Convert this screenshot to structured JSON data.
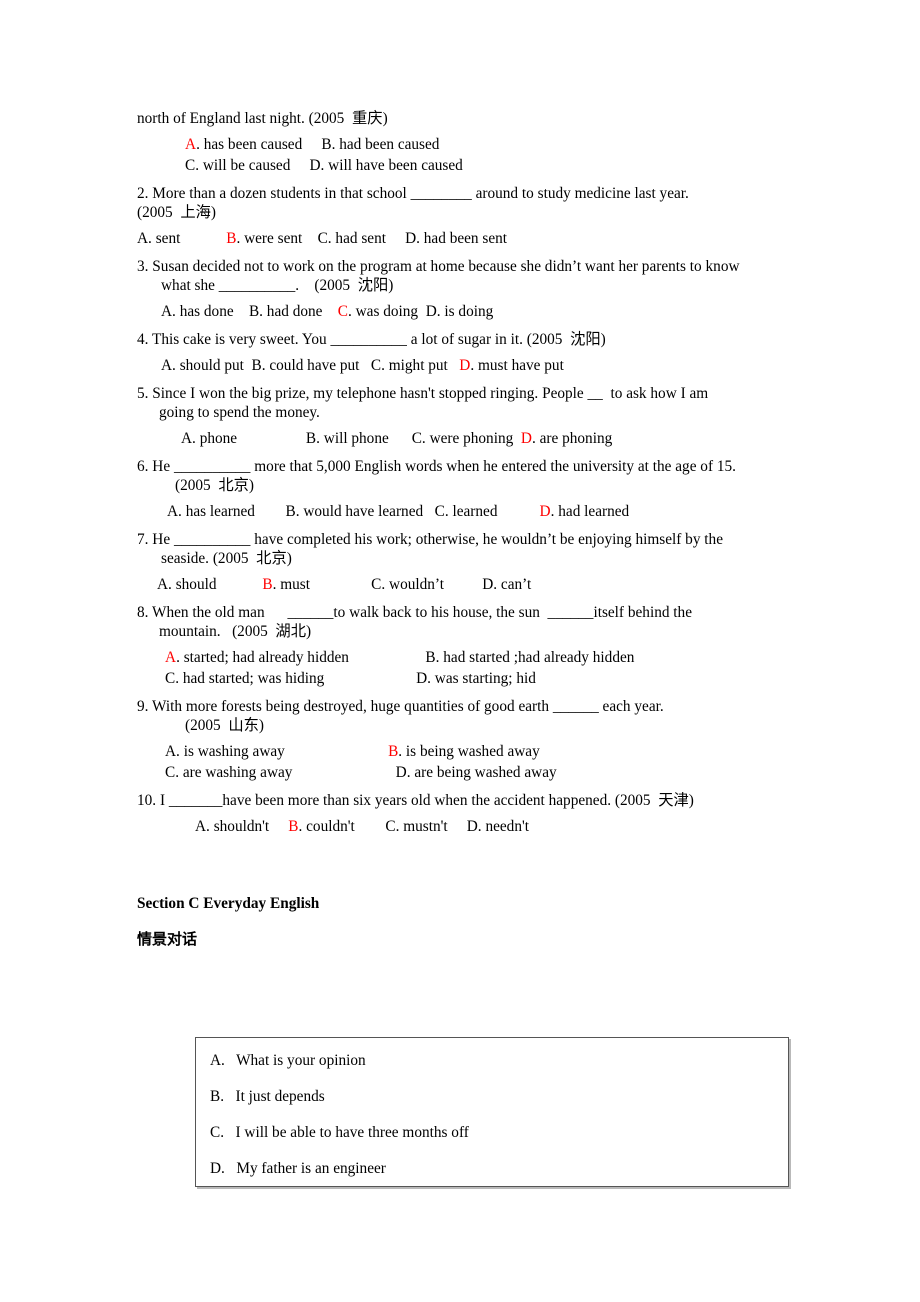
{
  "document": {
    "type": "grammar-exercise-worksheet",
    "accent_answer_color": "#ff0000",
    "text_color": "#000000",
    "background_color": "#ffffff"
  },
  "questions": [
    {
      "stem_lines": [
        {
          "text": "north of England last night. (2005  重庆)",
          "indent": 0
        }
      ],
      "option_lines": [
        {
          "answer_letter": "A",
          "prefix": "",
          "text": ". has been caused     B. had been caused",
          "indent": 48
        },
        {
          "answer_letter": "",
          "prefix": "",
          "text": "C. will be caused     D. will have been caused",
          "indent": 48
        }
      ]
    },
    {
      "stem_lines": [
        {
          "text": "2. More than a dozen students in that school ________ around to study medicine last year.",
          "indent": 0
        },
        {
          "text": "(2005  上海)",
          "indent": 0
        }
      ],
      "option_lines": [
        {
          "answer_letter": "B",
          "prefix": "A. sent            ",
          "text": ". were sent    C. had sent     D. had been sent",
          "indent": 0
        }
      ]
    },
    {
      "stem_lines": [
        {
          "text": "3. Susan decided not to work on the program at home because she didn’t want her parents to know",
          "indent": 0
        },
        {
          "text": "what she __________.    (2005  沈阳)",
          "indent": 24
        }
      ],
      "option_lines": [
        {
          "answer_letter": "C",
          "prefix": "A. has done    B. had done    ",
          "text": ". was doing  D. is doing",
          "indent": 24
        }
      ]
    },
    {
      "stem_lines": [
        {
          "text": "4. This cake is very sweet. You __________ a lot of sugar in it. (2005  沈阳)",
          "indent": 0
        }
      ],
      "option_lines": [
        {
          "answer_letter": "D",
          "prefix": "A. should put  B. could have put   C. might put   ",
          "text": ". must have put",
          "indent": 24
        }
      ]
    },
    {
      "stem_lines": [
        {
          "text": "5. Since I won the big prize, my telephone hasn't stopped ringing. People __  to ask how I am",
          "indent": 0
        },
        {
          "text": "going to spend the money.",
          "indent": 22
        }
      ],
      "option_lines": [
        {
          "answer_letter": "D",
          "prefix": "A. phone                  B. will phone      C. were phoning  ",
          "text": ". are phoning",
          "indent": 44
        }
      ]
    },
    {
      "stem_lines": [
        {
          "text": "6. He __________ more that 5,000 English words when he entered the university at the age of 15.",
          "indent": 0
        },
        {
          "text": "(2005  北京)",
          "indent": 38
        }
      ],
      "option_lines": [
        {
          "answer_letter": "D",
          "prefix": "A. has learned        B. would have learned   C. learned           ",
          "text": ". had learned",
          "indent": 30
        }
      ]
    },
    {
      "stem_lines": [
        {
          "text": "7. He __________ have completed his work; otherwise, he wouldn’t be enjoying himself by the",
          "indent": 0
        },
        {
          "text": "seaside. (2005  北京)",
          "indent": 24
        }
      ],
      "option_lines": [
        {
          "answer_letter": "B",
          "prefix": "A. should            ",
          "text": ". must                C. wouldn’t          D. can’t",
          "indent": 20
        }
      ]
    },
    {
      "stem_lines": [
        {
          "text": "8. When the old man      ______to walk back to his house, the sun  ______itself behind the",
          "indent": 0
        },
        {
          "text": "mountain.   (2005  湖北)",
          "indent": 22
        }
      ],
      "option_lines": [
        {
          "answer_letter": "A",
          "prefix": "",
          "text": ". started; had already hidden                    B. had started ;had already hidden",
          "indent": 28
        },
        {
          "answer_letter": "",
          "prefix": "",
          "text": "C. had started; was hiding                        D. was starting; hid",
          "indent": 28
        }
      ]
    },
    {
      "stem_lines": [
        {
          "text": "9. With more forests being destroyed, huge quantities of good earth ______ each year.",
          "indent": 0
        },
        {
          "text": "(2005  山东)",
          "indent": 48
        }
      ],
      "option_lines": [
        {
          "answer_letter": "B",
          "prefix": "A. is washing away                           ",
          "text": ". is being washed away",
          "indent": 28
        },
        {
          "answer_letter": "",
          "prefix": "",
          "text": "C. are washing away                           D. are being washed away",
          "indent": 28
        }
      ]
    },
    {
      "stem_lines": [
        {
          "text": "10. I _______have been more than six years old when the accident happened. (2005  天津)",
          "indent": 0
        }
      ],
      "option_lines": [
        {
          "answer_letter": "B",
          "prefix": "A. shouldn't     ",
          "text": ". couldn't        C. mustn't     D. needn't",
          "indent": 58
        }
      ]
    }
  ],
  "section_c": {
    "heading": "Section C Everyday English",
    "subheading": "情景对话"
  },
  "dialog_box": {
    "items": [
      {
        "label": "A.",
        "text": "What is your opinion"
      },
      {
        "label": "B.",
        "text": "It just depends"
      },
      {
        "label": "C.",
        "text": "I will be able to have three months off"
      },
      {
        "label": "D.",
        "text": "My father is an engineer"
      }
    ]
  }
}
